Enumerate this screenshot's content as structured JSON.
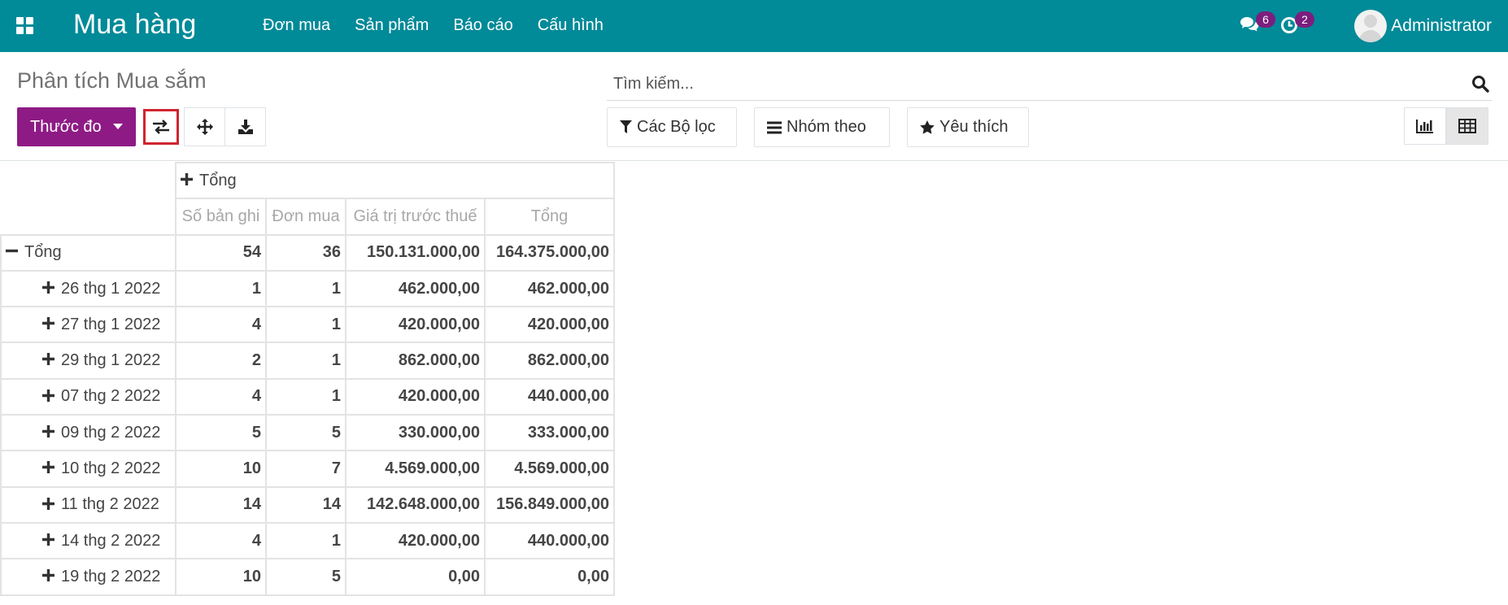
{
  "navbar": {
    "brand": "Mua hàng",
    "menu": [
      {
        "label": "Đơn mua"
      },
      {
        "label": "Sản phẩm"
      },
      {
        "label": "Báo cáo"
      },
      {
        "label": "Cấu hình"
      }
    ],
    "messages_count": "6",
    "activities_count": "2",
    "user_name": "Administrator",
    "color": "#018a98"
  },
  "control_panel": {
    "title": "Phân tích Mua sắm",
    "measures_label": "Thước đo",
    "search_placeholder": "Tìm kiếm...",
    "filters_label": "Các Bộ lọc",
    "group_by_label": "Nhóm theo",
    "favorites_label": "Yêu thích",
    "accent": "#8e1b85"
  },
  "pivot": {
    "col_header": "Tổng",
    "measures": [
      "Số bản ghi",
      "Đơn mua",
      "Giá trị trước thuế",
      "Tổng"
    ],
    "total_row": {
      "label": "Tổng",
      "values": [
        "54",
        "36",
        "150.131.000,00",
        "164.375.000,00"
      ]
    },
    "rows": [
      {
        "label": "26 thg 1 2022",
        "values": [
          "1",
          "1",
          "462.000,00",
          "462.000,00"
        ]
      },
      {
        "label": "27 thg 1 2022",
        "values": [
          "4",
          "1",
          "420.000,00",
          "420.000,00"
        ]
      },
      {
        "label": "29 thg 1 2022",
        "values": [
          "2",
          "1",
          "862.000,00",
          "862.000,00"
        ]
      },
      {
        "label": "07 thg 2 2022",
        "values": [
          "4",
          "1",
          "420.000,00",
          "440.000,00"
        ]
      },
      {
        "label": "09 thg 2 2022",
        "values": [
          "5",
          "5",
          "330.000,00",
          "333.000,00"
        ]
      },
      {
        "label": "10 thg 2 2022",
        "values": [
          "10",
          "7",
          "4.569.000,00",
          "4.569.000,00"
        ]
      },
      {
        "label": "11 thg 2 2022",
        "values": [
          "14",
          "14",
          "142.648.000,00",
          "156.849.000,00"
        ]
      },
      {
        "label": "14 thg 2 2022",
        "values": [
          "4",
          "1",
          "420.000,00",
          "440.000,00"
        ]
      },
      {
        "label": "19 thg 2 2022",
        "values": [
          "10",
          "5",
          "0,00",
          "0,00"
        ]
      }
    ]
  }
}
